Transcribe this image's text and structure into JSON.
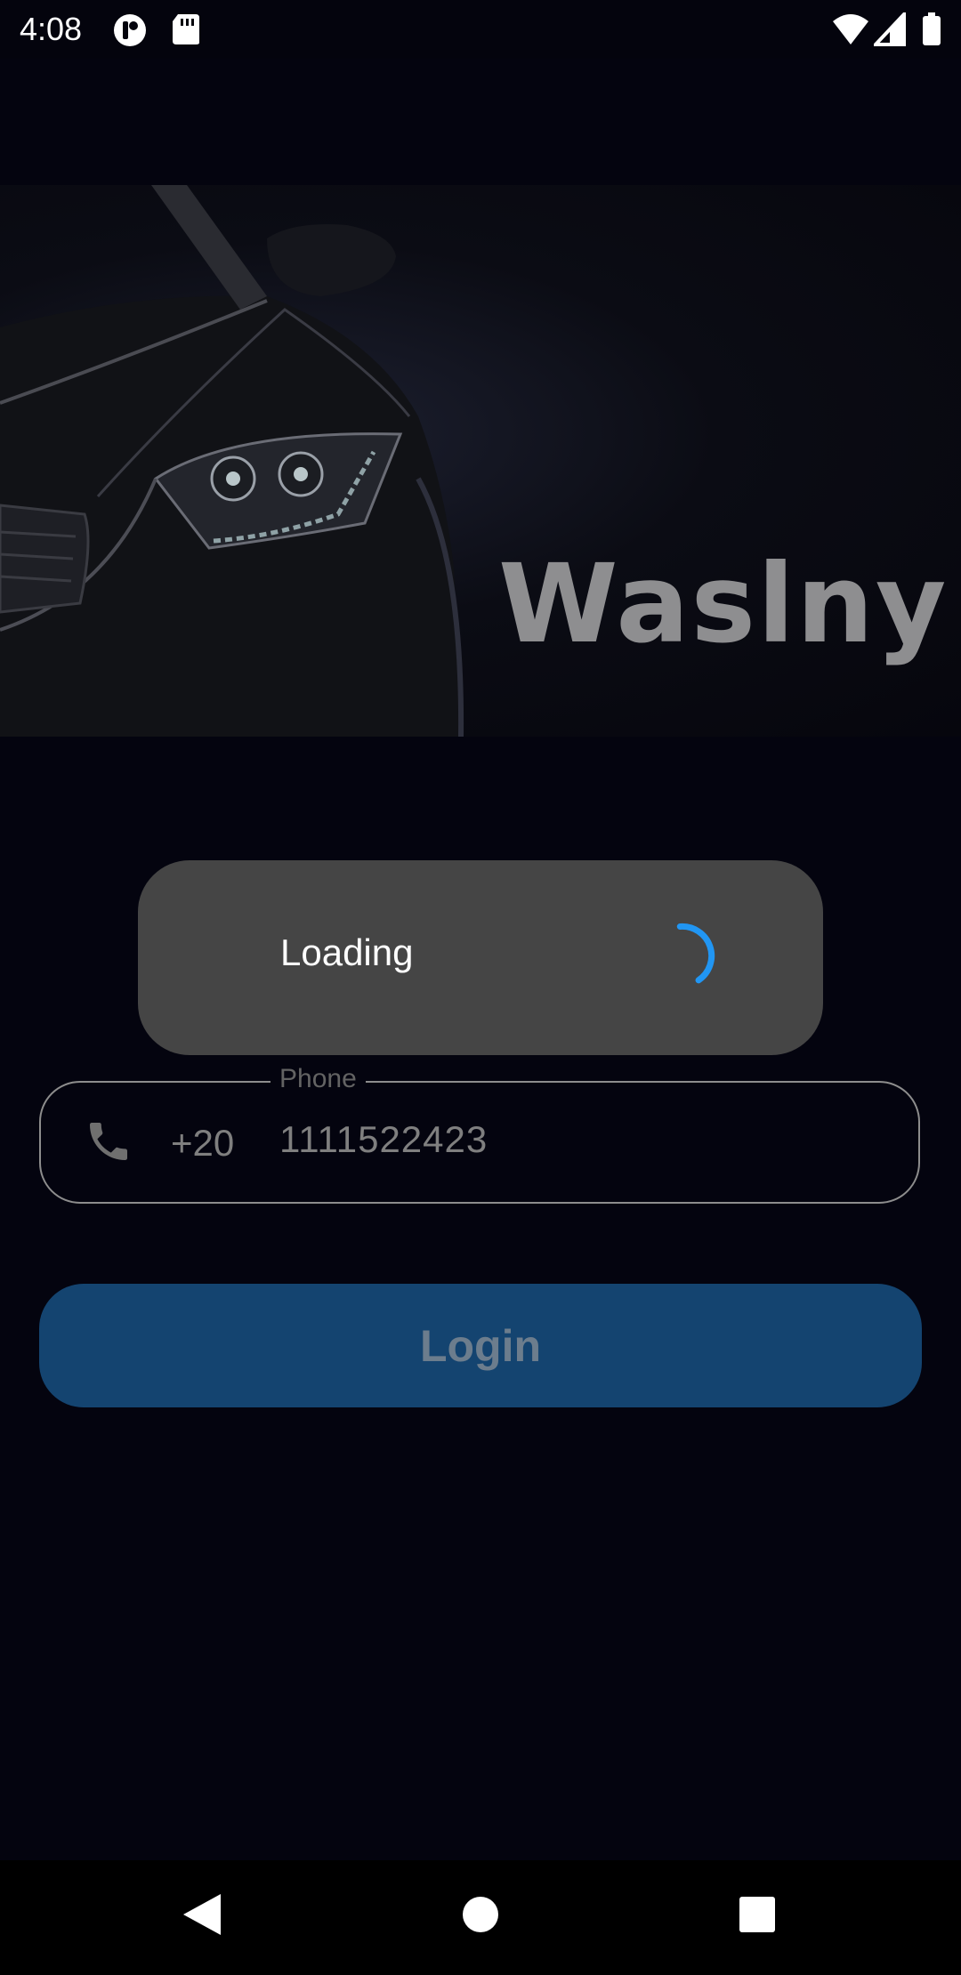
{
  "status_bar": {
    "time": "4:08",
    "icons": [
      "notification-app-icon",
      "sd-card-icon",
      "wifi-icon",
      "cellular-signal-icon",
      "battery-icon"
    ]
  },
  "hero": {
    "brand": "Waslny",
    "image": "car-headlight-image"
  },
  "loading_dialog": {
    "text": "Loading",
    "spinner_color": "#2196f3"
  },
  "phone_field": {
    "label": "Phone",
    "icon": "phone-icon",
    "country_code": "+20",
    "value": "1111522423"
  },
  "login_button": {
    "label": "Login",
    "color": "#144470"
  },
  "nav_bar": {
    "buttons": [
      "back-icon",
      "home-icon",
      "recents-icon"
    ]
  }
}
